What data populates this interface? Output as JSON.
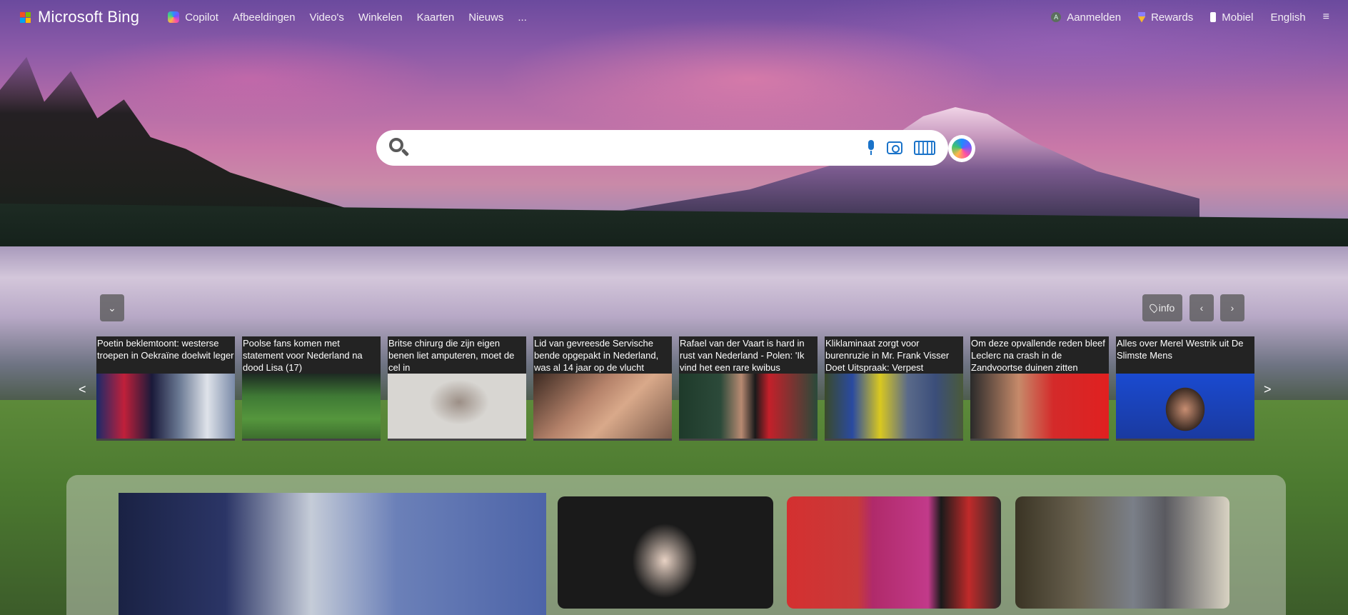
{
  "header": {
    "brand": "Microsoft Bing",
    "nav": [
      "Copilot",
      "Afbeeldingen",
      "Video's",
      "Winkelen",
      "Kaarten",
      "Nieuws",
      "..."
    ],
    "signin": "Aanmelden",
    "signin_initial": "A",
    "rewards": "Rewards",
    "mobile": "Mobiel",
    "language": "English",
    "menu_icon": "≡"
  },
  "search": {
    "value": "",
    "placeholder": ""
  },
  "controls": {
    "collapse_icon": "chevron-down-icon",
    "info_label": "info",
    "prev_icon": "chevron-left-icon",
    "next_icon": "chevron-right-icon"
  },
  "carousel": {
    "prev_label": "<",
    "next_label": ">",
    "items": [
      {
        "title": "Poetin beklemtoont: westerse troepen in Oekraïne doelwit leger"
      },
      {
        "title": "Poolse fans komen met statement voor Nederland na dood Lisa (17)"
      },
      {
        "title": "Britse chirurg die zijn eigen benen liet amputeren, moet de cel in"
      },
      {
        "title": "Lid van gevreesde Servische bende opgepakt in Nederland, was al 14 jaar op de vlucht"
      },
      {
        "title": "Rafael van der Vaart is hard in rust van Nederland - Polen: 'Ik vind het een rare kwibus"
      },
      {
        "title": "Kliklaminaat zorgt voor burenruzie in Mr. Frank Visser Doet Uitspraak: Verpest"
      },
      {
        "title": "Om deze opvallende reden bleef Leclerc na crash in de Zandvoortse duinen zitten"
      },
      {
        "title": "Alles over Merel Westrik uit De Slimste Mens"
      }
    ]
  },
  "colors": {
    "ms_red": "#f25022",
    "ms_green": "#7fba00",
    "ms_blue": "#00a4ef",
    "ms_yellow": "#ffb900",
    "search_icon_blue": "#1a73c9"
  }
}
